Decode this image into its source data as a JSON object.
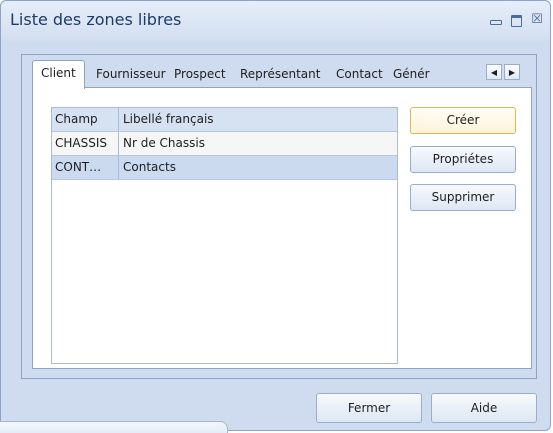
{
  "window": {
    "title": "Liste des zones libres",
    "controls": [
      "minimize-icon",
      "maximize-icon",
      "close-icon"
    ],
    "close_glyph": "☒"
  },
  "tabs": [
    {
      "label": "Client",
      "active": true
    },
    {
      "label": "Fournisseur",
      "active": false
    },
    {
      "label": "Prospect",
      "active": false
    },
    {
      "label": "Représentant",
      "active": false
    },
    {
      "label": "Contact",
      "active": false
    },
    {
      "label": "Génér",
      "active": false
    }
  ],
  "tab_scroll": {
    "left": "◀",
    "right": "▶"
  },
  "grid": {
    "columns": [
      "Champ",
      "Libellé français"
    ],
    "rows": [
      {
        "champ": "CHASSIS",
        "libelle": "Nr de Chassis"
      },
      {
        "champ": "CONT…",
        "libelle": "Contacts",
        "selected": true
      }
    ]
  },
  "actions": {
    "create": "Créer",
    "properties": "Propriétes",
    "delete": "Supprimer"
  },
  "footer": {
    "close": "Fermer",
    "help": "Aide"
  },
  "colors": {
    "accent": "#1f3a68",
    "default_button_border": "#e4b74c",
    "selected_row": "#ccdaef"
  }
}
